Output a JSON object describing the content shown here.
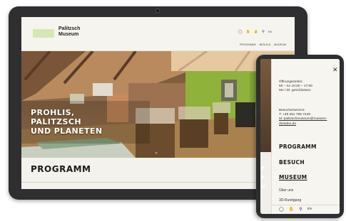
{
  "site": {
    "logo_line1": "Palitzsch",
    "logo_line2": "Museum",
    "lang": "EN",
    "nav": [
      "PROGRAMM",
      "BESUCH",
      "MUSEUM"
    ]
  },
  "hero": {
    "title_line1": "PROHLIS,",
    "title_line2": "PALITZSCH",
    "title_line3": "UND PLANETEN"
  },
  "section_title": "PROGRAMM",
  "phone": {
    "peek_letters": [
      "P",
      "P",
      "U"
    ],
    "hours": [
      "Öffnungszeiten:",
      "Mi – So 10:00 – 17:00",
      "Mo / Di: geschlossen"
    ],
    "contact": [
      "Besucherservice:",
      "T: +49 351 796 7249",
      "M: palitzschmuseum@museen-",
      "dresden.de"
    ],
    "menu_main": [
      "PROGRAMM",
      "BESUCH",
      "MUSEUM"
    ],
    "menu_sub": [
      "Über uns",
      "3D-Rundgang"
    ],
    "footer_lang": "EN"
  },
  "colors": {
    "logo_accent": "#d7e6b5",
    "device_frame": "#2f2f31",
    "page_bg": "#f6f4ee"
  },
  "icons": {
    "header": [
      "accessibility-icon",
      "hand-icon",
      "sign-language-icon",
      "search-icon"
    ],
    "footer": [
      "accessibility-icon",
      "hand-icon",
      "search-icon"
    ],
    "close": "close-icon",
    "scroll": "chevron-down-icon"
  }
}
